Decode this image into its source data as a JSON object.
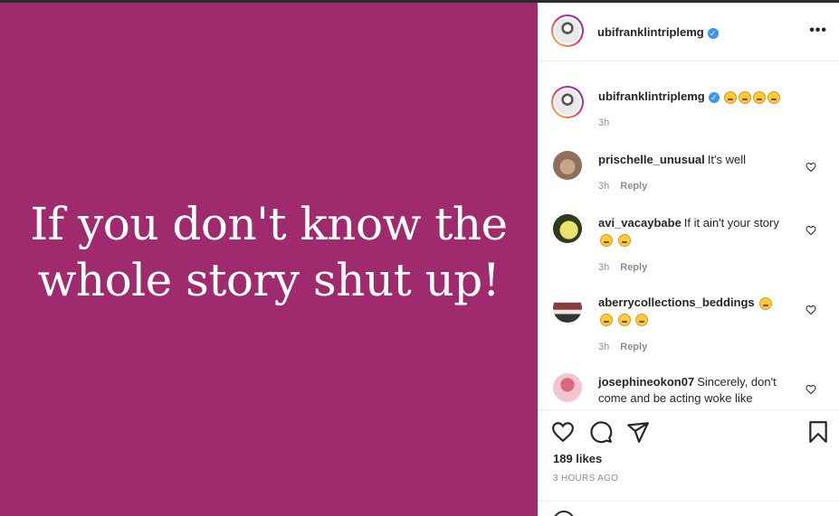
{
  "post": {
    "image_text": "If you don't know the whole story shut up!",
    "image_bg": "#a02a6e"
  },
  "header": {
    "username": "ubifranklintriplemg",
    "more_icon": "•••"
  },
  "caption": {
    "username": "ubifranklintriplemg",
    "time": "3h"
  },
  "comments": [
    {
      "user": "prischelle_unusual",
      "text": "It's well",
      "time": "3h",
      "reply": "Reply"
    },
    {
      "user": "avi_vacaybabe",
      "text": "If it ain't your story",
      "time": "3h",
      "reply": "Reply"
    },
    {
      "user": "aberrycollections_beddings",
      "text": "",
      "time": "3h",
      "reply": "Reply"
    },
    {
      "user": "josephineokon07",
      "text": "Sincerely, don't come and be acting woke like"
    }
  ],
  "actions": {
    "likes": "189 likes",
    "time_ago": "3 HOURS AGO"
  },
  "icons": [
    "more-icon",
    "verified-icon",
    "heart-icon",
    "comment-icon",
    "share-icon",
    "bookmark-icon",
    "emoji-icon"
  ],
  "colors": {
    "verified": "#3897f0",
    "muted": "#8e8e8e",
    "text": "#262626"
  }
}
